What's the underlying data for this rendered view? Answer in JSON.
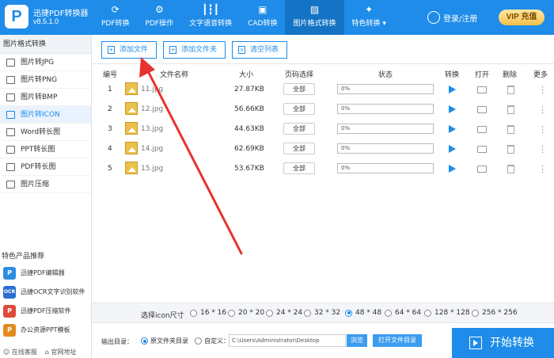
{
  "app": {
    "name": "迅捷PDF转换器",
    "version": "v8.5.1.0",
    "logo_letter": "P"
  },
  "nav": [
    {
      "label": "PDF转换",
      "icon": "refresh-icon"
    },
    {
      "label": "PDF操作",
      "icon": "gear-icon"
    },
    {
      "label": "文字语音转换",
      "icon": "audio-wave-icon"
    },
    {
      "label": "CAD转换",
      "icon": "cad-icon"
    },
    {
      "label": "图片格式转换",
      "icon": "image-icon",
      "active": true
    },
    {
      "label": "特色转换 ▾",
      "icon": "feature-icon"
    }
  ],
  "header": {
    "login": "登录/注册",
    "vip_label": "VIP",
    "vip_action": "充值"
  },
  "sidebar": {
    "title": "图片格式转换",
    "items": [
      {
        "label": "图片转JPG"
      },
      {
        "label": "图片转PNG"
      },
      {
        "label": "图片转BMP"
      },
      {
        "label": "图片转ICON",
        "active": true
      },
      {
        "label": "Word转长图"
      },
      {
        "label": "PPT转长图"
      },
      {
        "label": "PDF转长图"
      },
      {
        "label": "图片压缩"
      }
    ],
    "products_title": "特色产品推荐",
    "products": [
      {
        "label": "迅捷PDF编辑器",
        "badge": "P",
        "color": "#2d8de0"
      },
      {
        "label": "迅捷OCR文字识别软件",
        "badge": "OCR",
        "color": "#2a6fcf"
      },
      {
        "label": "迅捷PDF压缩软件",
        "badge": "P",
        "color": "#e0493b"
      },
      {
        "label": "办公资源PPT模板",
        "badge": "P",
        "color": "#e28b21"
      }
    ],
    "footer": {
      "service": "在线客服",
      "website": "官网地址"
    }
  },
  "toolbar": {
    "add_file": "添加文件",
    "add_folder": "添加文件夹",
    "clear_list": "清空列表"
  },
  "table": {
    "headers": {
      "num": "编号",
      "name": "文件名称",
      "size": "大小",
      "range": "页码选择",
      "status": "状态",
      "convert": "转换",
      "open": "打开",
      "delete": "删除",
      "more": "更多"
    },
    "rows": [
      {
        "num": "1",
        "name": "11.jpg",
        "size": "27.87KB",
        "range": "全部",
        "progress": "0%"
      },
      {
        "num": "2",
        "name": "12.jpg",
        "size": "56.66KB",
        "range": "全部",
        "progress": "0%"
      },
      {
        "num": "3",
        "name": "13.jpg",
        "size": "44.63KB",
        "range": "全部",
        "progress": "0%"
      },
      {
        "num": "4",
        "name": "14.jpg",
        "size": "62.69KB",
        "range": "全部",
        "progress": "0%"
      },
      {
        "num": "5",
        "name": "15.jpg",
        "size": "53.67KB",
        "range": "全部",
        "progress": "0%"
      }
    ]
  },
  "icon_size": {
    "label": "选择icon尺寸",
    "options": [
      "16 * 16",
      "20 * 20",
      "24 * 24",
      "32 * 32",
      "48 * 48",
      "64 * 64",
      "128 * 128",
      "256 * 256"
    ],
    "selected": "48 * 48"
  },
  "output": {
    "label": "输出目录：",
    "option_original": "原文件夹目录",
    "option_custom": "自定义：",
    "selected": "原文件夹目录",
    "path": "C:\\Users\\Administrator\\Desktop",
    "browse": "浏览",
    "open_folder": "打开文件目录"
  },
  "start_button": "开始转换",
  "colors": {
    "primary": "#1e8ce8",
    "annotation_arrow": "#e8322f"
  }
}
